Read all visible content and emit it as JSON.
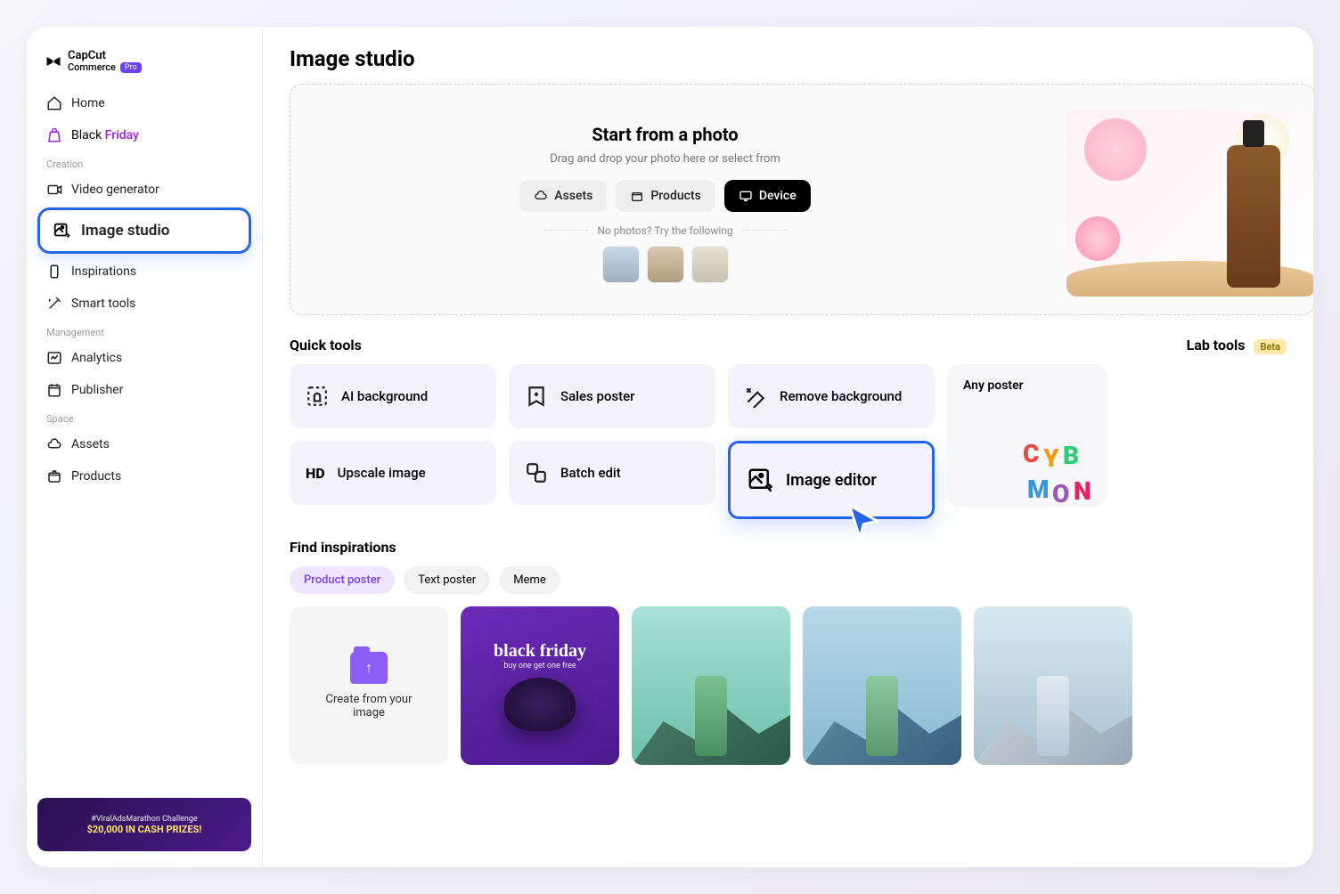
{
  "brand": {
    "name": "CapCut",
    "sub": "Commerce",
    "badge": "Pro"
  },
  "nav": {
    "home": "Home",
    "blackFriday_black": "Black",
    "blackFriday_friday": "Friday",
    "section_creation": "Creation",
    "videoGenerator": "Video generator",
    "imageStudio": "Image studio",
    "inspirations": "Inspirations",
    "smartTools": "Smart tools",
    "section_management": "Management",
    "analytics": "Analytics",
    "publisher": "Publisher",
    "section_space": "Space",
    "assets": "Assets",
    "products": "Products"
  },
  "promo": {
    "line1": "#ViralAdsMarathon Challenge",
    "line2": "$20,000 IN CASH PRIZES!"
  },
  "page": {
    "title": "Image studio"
  },
  "upload": {
    "title": "Start from a photo",
    "subtitle": "Drag and drop your photo here or select from",
    "btn_assets": "Assets",
    "btn_products": "Products",
    "btn_device": "Device",
    "try_text": "No photos? Try the following"
  },
  "quickTools": {
    "heading": "Quick tools",
    "ai_background": "AI background",
    "sales_poster": "Sales poster",
    "remove_background": "Remove background",
    "upscale_image": "Upscale image",
    "batch_edit": "Batch edit",
    "image_editor": "Image editor"
  },
  "labTools": {
    "heading": "Lab tools",
    "badge": "Beta",
    "any_poster": "Any poster"
  },
  "inspirations": {
    "heading": "Find inspirations",
    "chip_product": "Product poster",
    "chip_text": "Text poster",
    "chip_meme": "Meme",
    "create_label": "Create from your image",
    "bf_title": "black friday",
    "bf_sub": "buy one get one free"
  }
}
